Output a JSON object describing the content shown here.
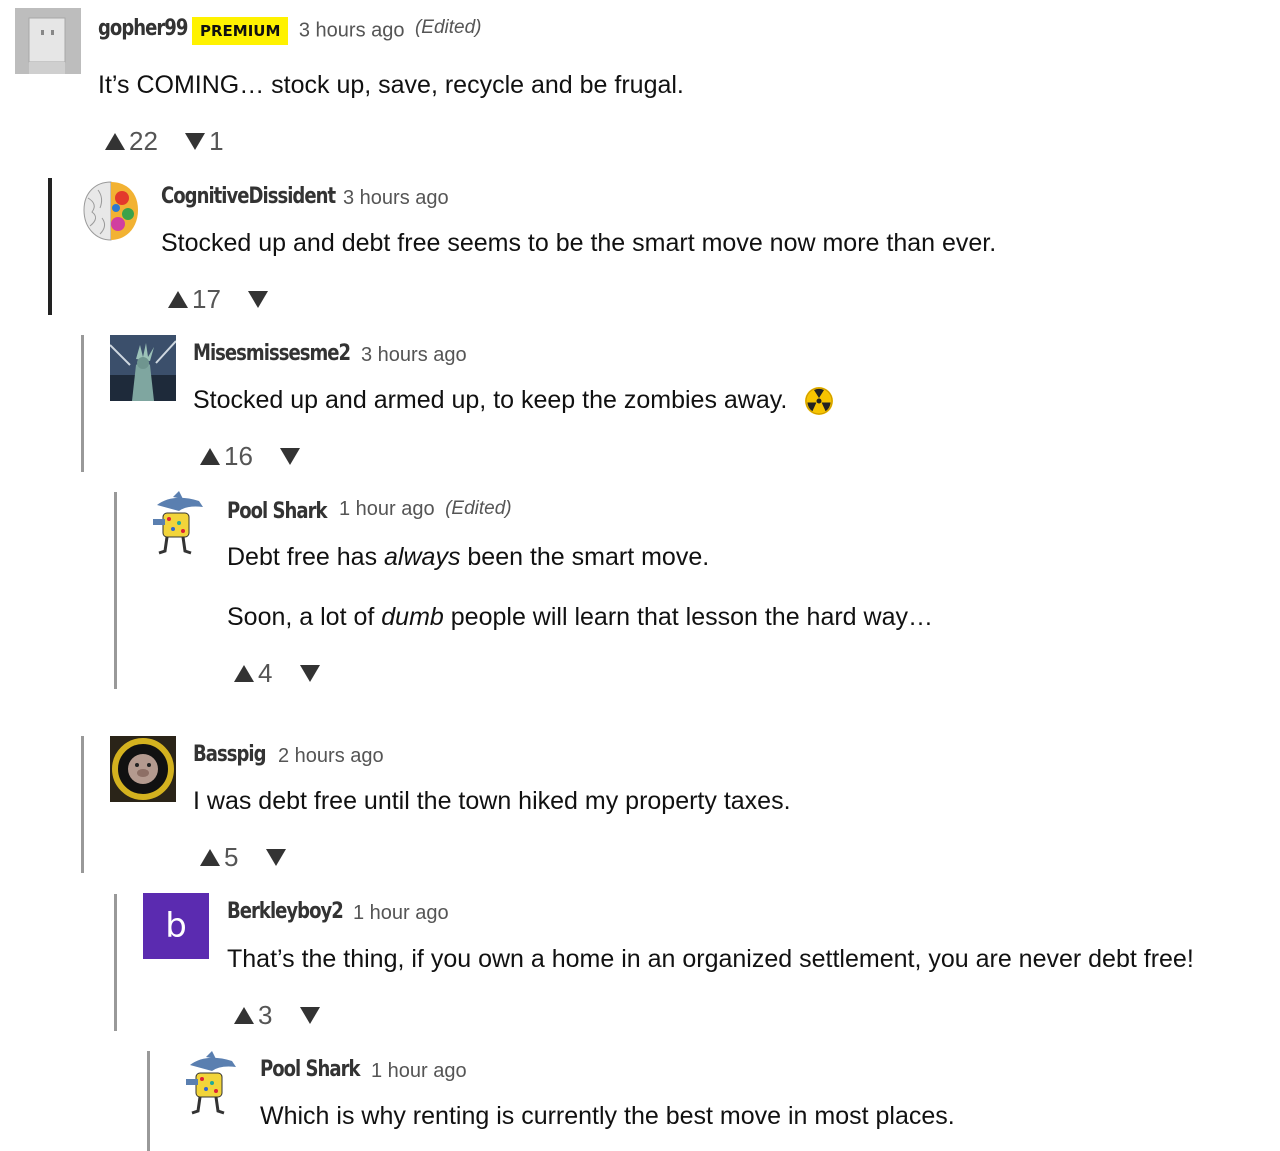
{
  "comments": [
    {
      "username": "gopher99",
      "badge": "PREMIUM",
      "time": "3 hours ago",
      "edited": "(Edited)",
      "body": "It’s COMING… stock up, save, recycle and be frugal.",
      "upvotes": "22",
      "downvotes": "1"
    },
    {
      "username": "CognitiveDissident",
      "time": "3 hours ago",
      "body": "Stocked up and debt free seems to be the smart move now more than ever.",
      "upvotes": "17"
    },
    {
      "username": "Misesmissesme2",
      "time": "3 hours ago",
      "body": "Stocked up and armed up, to keep the zombies away.",
      "emoji": "radioactive-emoji",
      "upvotes": "16"
    },
    {
      "username": "Pool Shark",
      "time": "1 hour ago",
      "edited": "(Edited)",
      "body_para1_a": "Debt free has ",
      "body_para1_em": "always",
      "body_para1_b": " been the smart move.",
      "body_para2_a": "Soon, a lot of ",
      "body_para2_em": "dumb",
      "body_para2_b": " people will learn that lesson the hard way…",
      "upvotes": "4"
    },
    {
      "username": "Basspig",
      "time": "2 hours ago",
      "body": "I was debt free until the town hiked my property taxes.",
      "upvotes": "5"
    },
    {
      "username": "Berkleyboy2",
      "avatar_letter": "b",
      "time": "1 hour ago",
      "body": "That’s the thing, if you own a home in an organized settlement, you are never debt free!",
      "upvotes": "3"
    },
    {
      "username": "Pool Shark",
      "time": "1 hour ago",
      "body": "Which is why renting is currently the best move in most places."
    }
  ],
  "colors": {
    "premium_badge": "#fff200",
    "avatar_b": "#5b2bb0",
    "thread_dark": "#222222",
    "thread_light": "#999999"
  }
}
